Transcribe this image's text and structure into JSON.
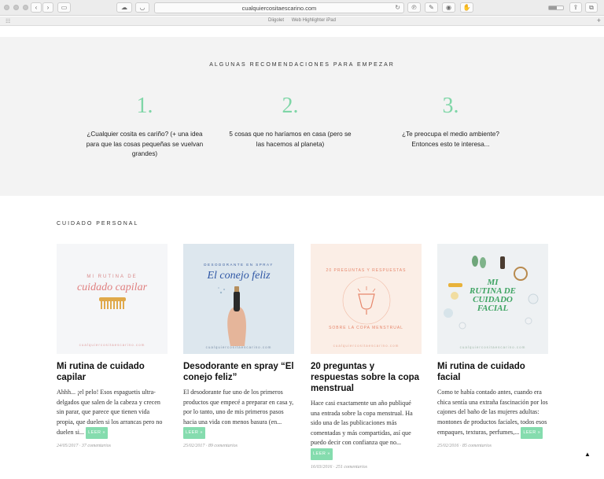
{
  "browser": {
    "url": "cualquiercositaescarino.com",
    "bookmarks": [
      "Diigolet",
      "Web Highlighter iPad"
    ],
    "page_load_progress": 0.55,
    "icons": [
      "back-arrow-icon",
      "forward-arrow-icon",
      "sidebar-icon",
      "cloud-icon",
      "pocket-icon",
      "reload-icon",
      "pinterest-icon",
      "bookmarklet-icon",
      "onepassword-icon",
      "evernote-icon",
      "share-icon",
      "tabs-icon",
      "plus-icon"
    ]
  },
  "recommendations": {
    "title": "ALGUNAS RECOMENDACIONES PARA EMPEZAR",
    "items": [
      {
        "number": "1.",
        "text": "¿Cualquier cosita es cariño? (+ una idea para que las cosas pequeñas se vuelvan grandes)"
      },
      {
        "number": "2.",
        "text": "5 cosas que no haríamos en casa (pero se las hacemos al planeta)"
      },
      {
        "number": "3.",
        "text": "¿Te preocupa el medio ambiente? Entonces esto te interesa..."
      }
    ]
  },
  "category": {
    "title": "CUIDADO PERSONAL",
    "read_more_label": "LEER »",
    "posts": [
      {
        "image_text": [
          "MI RUTINA DE",
          "cuidado capilar"
        ],
        "image_footer": "cualquiercositaescarino.com",
        "title": "Mi rutina de cuidado capilar",
        "excerpt": "Ahhh... ¡el pelo! Esos espaguetis ultra-delgados que salen de la cabeza y crecen sin parar, que parece que tienen vida propia, que duelen si los arrancas pero no duelen si...",
        "meta": "24/05/2017 · 37 comentarios"
      },
      {
        "image_text": [
          "DESODORANTE EN SPRAY",
          "El conejo feliz"
        ],
        "image_footer": "cualquiercositaescarino.com",
        "title": "Desodorante en spray “El conejo feliz”",
        "excerpt": "El desodorante fue uno de los primeros productos que empecé a preparar en casa y, por lo tanto, uno de mis primeros pasos hacia una vida con menos basura (en...",
        "meta": "25/02/2017 · 89 comentarios"
      },
      {
        "image_text": [
          "20 PREGUNTAS Y RESPUESTAS",
          "SOBRE LA COPA MENSTRUAL"
        ],
        "image_footer": "cualquiercositaescarino.com",
        "title": "20 preguntas y respuestas sobre la copa menstrual",
        "excerpt": "Hace casi exactamente un año publiqué una entrada sobre la copa menstrual. Ha sido una de las publicaciones más comentadas y más compartidas, así que puedo decir con confianza que no...",
        "meta": "16/03/2016 · 251 comentarios"
      },
      {
        "image_text": [
          "MI",
          "RUTINA DE",
          "CUIDADO",
          "FACIAL"
        ],
        "image_footer": "cualquiercositaescarino.com",
        "title": "Mi rutina de cuidado facial",
        "excerpt": "Como te había contado antes, cuando era chica sentía una extraña fascinación por los cajones del baño de las mujeres adultas: montones de productos faciales, todos esos empaques, texturas, perfumes,...",
        "meta": "25/02/2016 · 85 comentarios"
      }
    ]
  }
}
